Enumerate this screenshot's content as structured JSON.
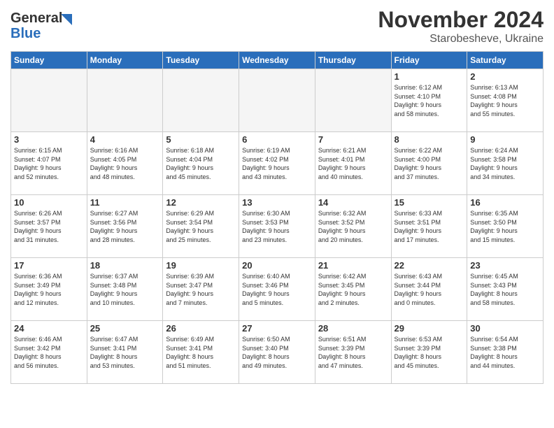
{
  "header": {
    "logo_general": "General",
    "logo_blue": "Blue",
    "month_title": "November 2024",
    "subtitle": "Starobesheve, Ukraine"
  },
  "days_of_week": [
    "Sunday",
    "Monday",
    "Tuesday",
    "Wednesday",
    "Thursday",
    "Friday",
    "Saturday"
  ],
  "weeks": [
    [
      {
        "day": "",
        "info": ""
      },
      {
        "day": "",
        "info": ""
      },
      {
        "day": "",
        "info": ""
      },
      {
        "day": "",
        "info": ""
      },
      {
        "day": "",
        "info": ""
      },
      {
        "day": "1",
        "info": "Sunrise: 6:12 AM\nSunset: 4:10 PM\nDaylight: 9 hours\nand 58 minutes."
      },
      {
        "day": "2",
        "info": "Sunrise: 6:13 AM\nSunset: 4:08 PM\nDaylight: 9 hours\nand 55 minutes."
      }
    ],
    [
      {
        "day": "3",
        "info": "Sunrise: 6:15 AM\nSunset: 4:07 PM\nDaylight: 9 hours\nand 52 minutes."
      },
      {
        "day": "4",
        "info": "Sunrise: 6:16 AM\nSunset: 4:05 PM\nDaylight: 9 hours\nand 48 minutes."
      },
      {
        "day": "5",
        "info": "Sunrise: 6:18 AM\nSunset: 4:04 PM\nDaylight: 9 hours\nand 45 minutes."
      },
      {
        "day": "6",
        "info": "Sunrise: 6:19 AM\nSunset: 4:02 PM\nDaylight: 9 hours\nand 43 minutes."
      },
      {
        "day": "7",
        "info": "Sunrise: 6:21 AM\nSunset: 4:01 PM\nDaylight: 9 hours\nand 40 minutes."
      },
      {
        "day": "8",
        "info": "Sunrise: 6:22 AM\nSunset: 4:00 PM\nDaylight: 9 hours\nand 37 minutes."
      },
      {
        "day": "9",
        "info": "Sunrise: 6:24 AM\nSunset: 3:58 PM\nDaylight: 9 hours\nand 34 minutes."
      }
    ],
    [
      {
        "day": "10",
        "info": "Sunrise: 6:26 AM\nSunset: 3:57 PM\nDaylight: 9 hours\nand 31 minutes."
      },
      {
        "day": "11",
        "info": "Sunrise: 6:27 AM\nSunset: 3:56 PM\nDaylight: 9 hours\nand 28 minutes."
      },
      {
        "day": "12",
        "info": "Sunrise: 6:29 AM\nSunset: 3:54 PM\nDaylight: 9 hours\nand 25 minutes."
      },
      {
        "day": "13",
        "info": "Sunrise: 6:30 AM\nSunset: 3:53 PM\nDaylight: 9 hours\nand 23 minutes."
      },
      {
        "day": "14",
        "info": "Sunrise: 6:32 AM\nSunset: 3:52 PM\nDaylight: 9 hours\nand 20 minutes."
      },
      {
        "day": "15",
        "info": "Sunrise: 6:33 AM\nSunset: 3:51 PM\nDaylight: 9 hours\nand 17 minutes."
      },
      {
        "day": "16",
        "info": "Sunrise: 6:35 AM\nSunset: 3:50 PM\nDaylight: 9 hours\nand 15 minutes."
      }
    ],
    [
      {
        "day": "17",
        "info": "Sunrise: 6:36 AM\nSunset: 3:49 PM\nDaylight: 9 hours\nand 12 minutes."
      },
      {
        "day": "18",
        "info": "Sunrise: 6:37 AM\nSunset: 3:48 PM\nDaylight: 9 hours\nand 10 minutes."
      },
      {
        "day": "19",
        "info": "Sunrise: 6:39 AM\nSunset: 3:47 PM\nDaylight: 9 hours\nand 7 minutes."
      },
      {
        "day": "20",
        "info": "Sunrise: 6:40 AM\nSunset: 3:46 PM\nDaylight: 9 hours\nand 5 minutes."
      },
      {
        "day": "21",
        "info": "Sunrise: 6:42 AM\nSunset: 3:45 PM\nDaylight: 9 hours\nand 2 minutes."
      },
      {
        "day": "22",
        "info": "Sunrise: 6:43 AM\nSunset: 3:44 PM\nDaylight: 9 hours\nand 0 minutes."
      },
      {
        "day": "23",
        "info": "Sunrise: 6:45 AM\nSunset: 3:43 PM\nDaylight: 8 hours\nand 58 minutes."
      }
    ],
    [
      {
        "day": "24",
        "info": "Sunrise: 6:46 AM\nSunset: 3:42 PM\nDaylight: 8 hours\nand 56 minutes."
      },
      {
        "day": "25",
        "info": "Sunrise: 6:47 AM\nSunset: 3:41 PM\nDaylight: 8 hours\nand 53 minutes."
      },
      {
        "day": "26",
        "info": "Sunrise: 6:49 AM\nSunset: 3:41 PM\nDaylight: 8 hours\nand 51 minutes."
      },
      {
        "day": "27",
        "info": "Sunrise: 6:50 AM\nSunset: 3:40 PM\nDaylight: 8 hours\nand 49 minutes."
      },
      {
        "day": "28",
        "info": "Sunrise: 6:51 AM\nSunset: 3:39 PM\nDaylight: 8 hours\nand 47 minutes."
      },
      {
        "day": "29",
        "info": "Sunrise: 6:53 AM\nSunset: 3:39 PM\nDaylight: 8 hours\nand 45 minutes."
      },
      {
        "day": "30",
        "info": "Sunrise: 6:54 AM\nSunset: 3:38 PM\nDaylight: 8 hours\nand 44 minutes."
      }
    ]
  ]
}
